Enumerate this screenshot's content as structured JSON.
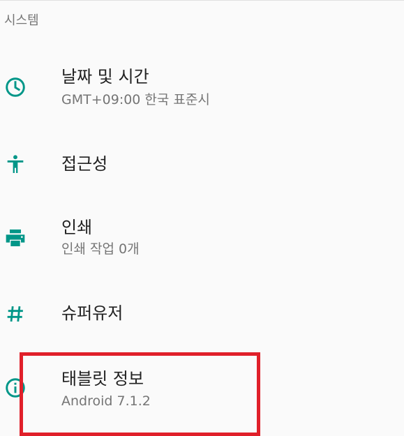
{
  "section": {
    "title": "시스템"
  },
  "items": [
    {
      "title": "날짜 및 시간",
      "subtitle": "GMT+09:00 한국 표준시",
      "icon": "clock-icon"
    },
    {
      "title": "접근성",
      "subtitle": "",
      "icon": "accessibility-icon"
    },
    {
      "title": "인쇄",
      "subtitle": "인쇄 작업 0개",
      "icon": "printer-icon"
    },
    {
      "title": "슈퍼유저",
      "subtitle": "",
      "icon": "hash-icon"
    },
    {
      "title": "태블릿 정보",
      "subtitle": "Android 7.1.2",
      "icon": "info-icon"
    }
  ],
  "colors": {
    "accent": "#009688",
    "highlight": "#e0202a"
  }
}
